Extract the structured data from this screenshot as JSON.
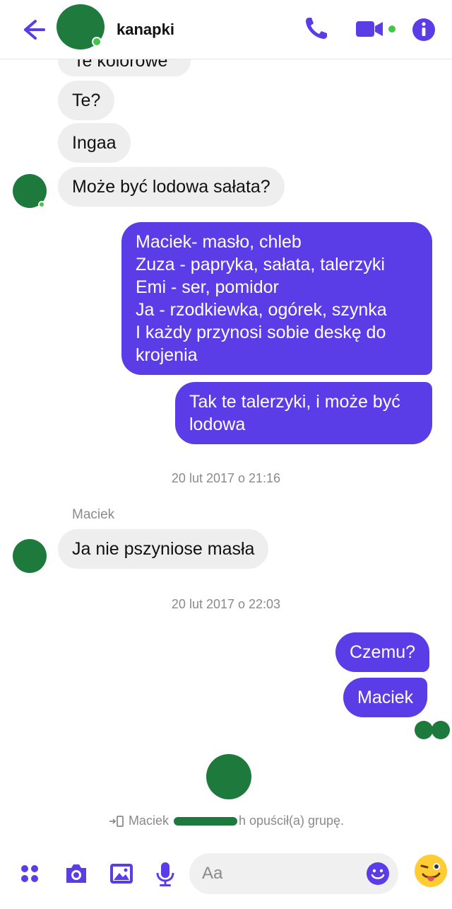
{
  "header": {
    "title": "kanapki"
  },
  "messages": {
    "partial": "Te kolorowe",
    "m1": "Te?",
    "m2": "Ingaa",
    "m3": "Może być lodowa sałata?",
    "out1": "Maciek-  masło, chleb\nZuza - papryka, sałata, talerzyki\nEmi - ser, pomidor\nJa - rzodkiewka, ogórek, szynka\nI każdy przynosi sobie deskę do krojenia",
    "out2": "Tak te talerzyki, i może być lodowa",
    "ts1": "20 lut 2017 o 21:16",
    "sender": "Maciek",
    "m4": "Ja nie pszyniose masła",
    "ts2": "20 lut 2017 o 22:03",
    "out3": "Czemu?",
    "out4": "Maciek"
  },
  "system": {
    "name": "Maciek",
    "action": "h opuścił(a) grupę."
  },
  "composer": {
    "placeholder": "Aa"
  },
  "colors": {
    "accent": "#5b3de8",
    "incoming": "#eeeeee",
    "avatar": "#1d7a3c"
  }
}
